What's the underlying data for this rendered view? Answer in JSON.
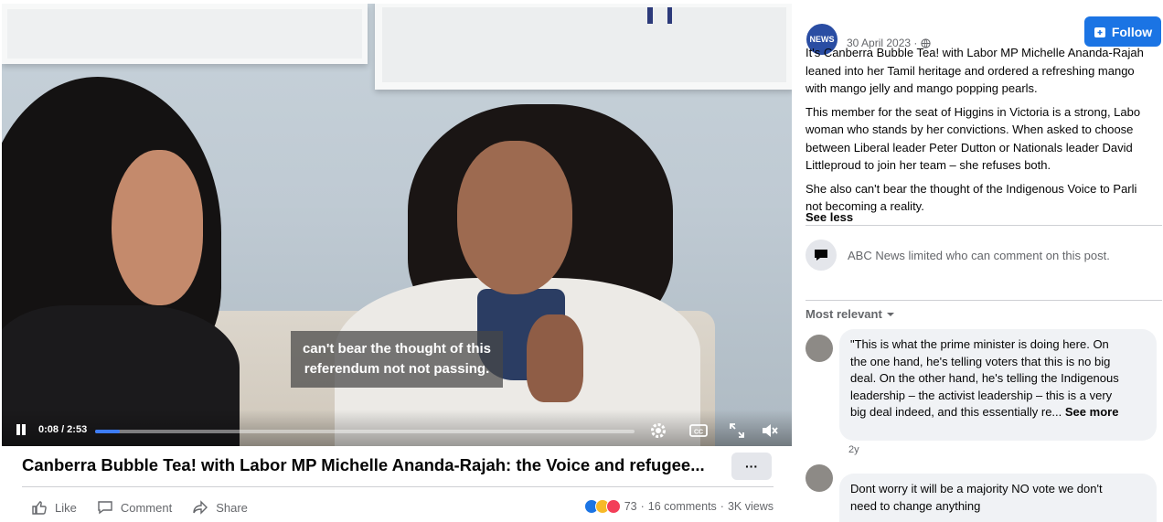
{
  "video": {
    "caption_line1": "can't bear the thought of this",
    "caption_line2": "referendum not not passing.",
    "time": "0:08 / 2:53",
    "progress": 0.046
  },
  "post": {
    "title": "Canberra Bubble Tea! with Labor MP Michelle Ananda-Rajah: the Voice and refugee...",
    "more_label": "···",
    "like_label": "Like",
    "comment_label": "Comment",
    "share_label": "Share",
    "reaction_count": "73",
    "comments_count": "16 comments",
    "views": "3K views",
    "separator": "·"
  },
  "side": {
    "page_logo": "NEWS",
    "date": "30 April 2023 ·",
    "follow_label": "Follow",
    "paragraphs": [
      "It's Canberra Bubble Tea! with Labor MP Michelle Ananda-Rajah",
      "leaned into her Tamil heritage and ordered a refreshing mango",
      "with mango jelly and mango popping pearls.",
      "This member for the seat of Higgins in Victoria is a strong, Labo",
      "woman who stands by her convictions. When asked to choose",
      "between Liberal leader Peter Dutton or Nationals leader David",
      "Littleproud to join her team – she refuses both.",
      "She also can't bear the thought of the Indigenous Voice to Parli",
      "not becoming a reality."
    ],
    "see_less": "See less",
    "comment_notice": "ABC News limited who can comment on this post.",
    "most_relevant": "Most relevant",
    "comment1_lines": [
      "\"This is what the prime minister is doing here. On",
      "the one hand, he's telling voters that this is no big",
      "deal. On the other hand, he's telling the Indigenous",
      "leadership – the activist leadership – this is a very"
    ],
    "comment1_last": "big deal indeed, and this essentially re...",
    "see_more": "See more",
    "comment1_time": "2y",
    "comment2_line1": "Dont worry it will be a majority NO vote we don't",
    "comment2_line2": "need to change anything"
  },
  "colors": {
    "accent": "#1b74e4",
    "progress": "#3d7cf6"
  }
}
